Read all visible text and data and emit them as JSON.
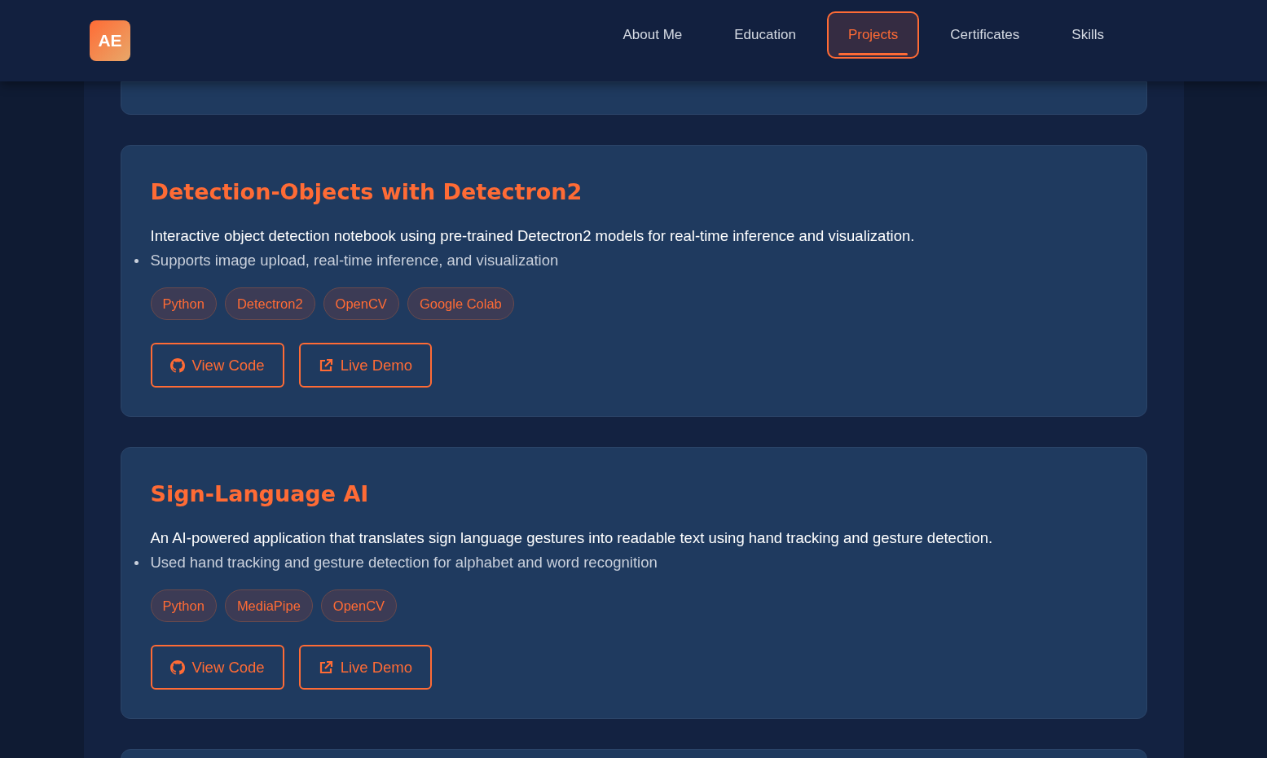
{
  "header": {
    "logo": "AE",
    "nav": [
      {
        "label": "About Me",
        "selected": false
      },
      {
        "label": "Education",
        "selected": false
      },
      {
        "label": "Projects",
        "selected": true
      },
      {
        "label": "Certificates",
        "selected": false
      },
      {
        "label": "Skills",
        "selected": false
      }
    ]
  },
  "projects": [
    {
      "title": "Detection-Objects with Detectron2",
      "description": "Interactive object detection notebook using pre-trained Detectron2 models for real-time inference and visualization.",
      "bullets": [
        "Supports image upload, real-time inference, and visualization"
      ],
      "tags": [
        "Python",
        "Detectron2",
        "OpenCV",
        "Google Colab"
      ],
      "buttons": [
        {
          "label": "View Code",
          "kind": "code"
        },
        {
          "label": "Live Demo",
          "kind": "demo"
        }
      ]
    },
    {
      "title": "Sign-Language AI",
      "description": "An AI-powered application that translates sign language gestures into readable text using hand tracking and gesture detection.",
      "bullets": [
        "Used hand tracking and gesture detection for alphabet and word recognition"
      ],
      "tags": [
        "Python",
        "MediaPipe",
        "OpenCV"
      ],
      "buttons": [
        {
          "label": "View Code",
          "kind": "code"
        },
        {
          "label": "Live Demo",
          "kind": "demo"
        }
      ]
    }
  ]
}
